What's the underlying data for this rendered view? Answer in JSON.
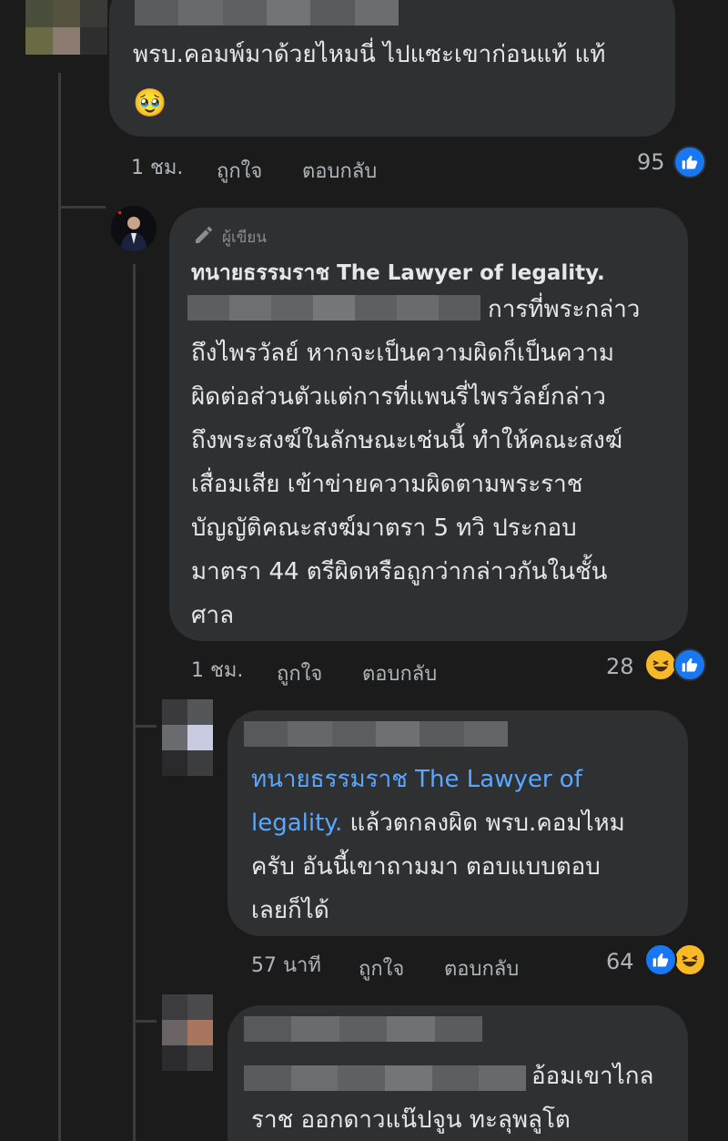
{
  "comment1": {
    "text_line1": "พรบ.คอมพ์มาด้วยไหมนี่ ไปแซะเขาก่อนแท้ แท้",
    "emoji": "🥹",
    "time": "1 ชม.",
    "like_label": "ถูกใจ",
    "reply_label": "ตอบกลับ",
    "reaction_count": "95",
    "reaction_icons": [
      "like-icon"
    ]
  },
  "reply1": {
    "badge_label": "ผู้เขียน",
    "author": "ทนายธรรมราช The Lawyer of  legality.",
    "lines": [
      "การที่พระกล่าว",
      "ถึงไพรวัลย์ หากจะเป็นความผิดก็เป็นความ",
      "ผิดต่อส่วนตัวแต่การที่แพนรี่ไพรวัลย์กล่าว",
      "ถึงพระสงฆ์ในลักษณะเช่นนี้ ทำให้คณะสงฆ์",
      "เสื่อมเสีย เข้าข่ายความผิดตามพระราช",
      "บัญญัติคณะสงฆ์มาตรา 5 ทวิ ประกอบ",
      "มาตรา 44 ตรีผิดหรือถูกว่ากล่าวกันในชั้น",
      "ศาล"
    ],
    "time": "1 ชม.",
    "like_label": "ถูกใจ",
    "reply_label": "ตอบกลับ",
    "reaction_count": "28",
    "reaction_icons": [
      "haha-icon",
      "like-icon"
    ]
  },
  "reply2": {
    "mention_line1": "ทนายธรรมราช The Lawyer of",
    "mention_line2": "legality.",
    "text_line2_rest": " แล้วตกลงผิด พรบ.คอมไหม",
    "text_line3": "ครับ อันนี้เขาถามมา ตอบแบบตอบ",
    "text_line4": "เลยก็ได้",
    "time": "57 นาที",
    "like_label": "ถูกใจ",
    "reply_label": "ตอบกลับ",
    "reaction_count": "64",
    "reaction_icons": [
      "like-icon",
      "haha-icon"
    ]
  },
  "reply3": {
    "text_line1": "อ้อมเขาไกล",
    "text_line2": "ราช ออกดาวแน๊ปจูน ทะลุพลูโต"
  },
  "colors": {
    "background": "#1b1b1b",
    "bubble": "#2f3032",
    "text": "#e6e7ea",
    "meta": "#b0b3b8",
    "mention": "#5aa7ff",
    "like_blue": "#1877f2",
    "haha_yellow": "#f7b928"
  }
}
